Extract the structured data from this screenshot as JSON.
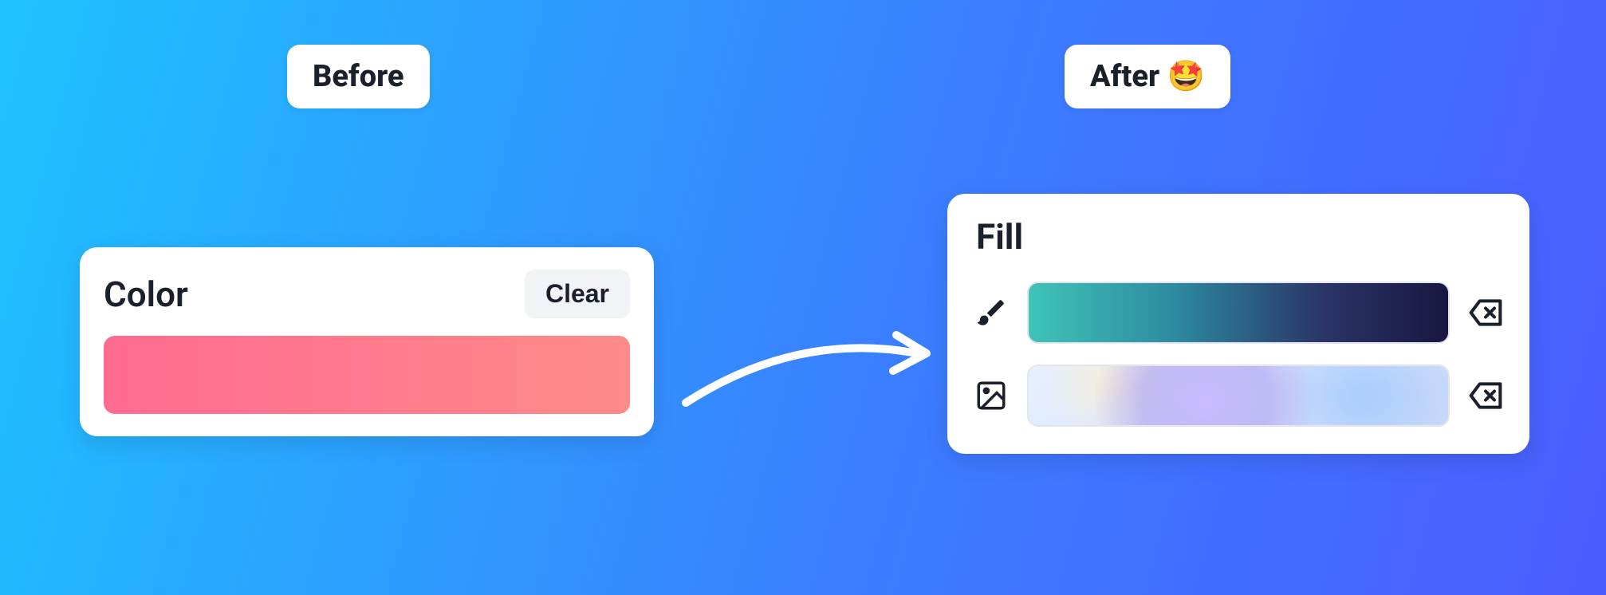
{
  "badges": {
    "before": "Before",
    "after": "After 🤩"
  },
  "before_card": {
    "title": "Color",
    "clear_button": "Clear",
    "swatch_gradient": "linear-gradient(90deg, #ff6b8f 0%, #ff8a8a 100%)"
  },
  "after_card": {
    "title": "Fill",
    "rows": [
      {
        "icon": "brush-icon",
        "type": "gradient"
      },
      {
        "icon": "image-icon",
        "type": "image"
      }
    ]
  }
}
